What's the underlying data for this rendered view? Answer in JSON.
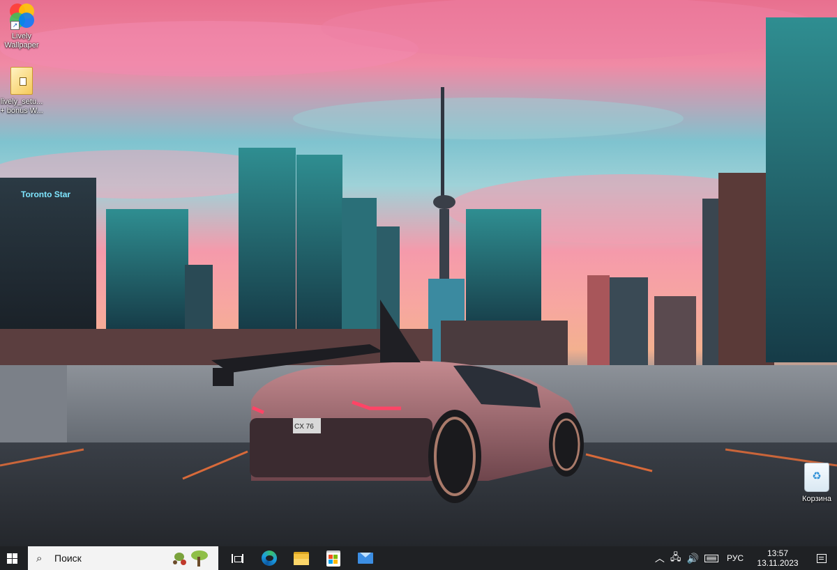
{
  "desktop": {
    "icons": [
      {
        "label": "Lively\nWallpaper",
        "icon": "lively-wallpaper-icon"
      },
      {
        "label": "lively_setu...\n+ bonus W...",
        "icon": "zip-archive-icon"
      },
      {
        "label": "Корзина",
        "icon": "recycle-bin-icon"
      }
    ],
    "wallpaper": {
      "signage": "Toronto Star",
      "plate": "CX 76"
    }
  },
  "taskbar": {
    "search": {
      "placeholder": "Поиск"
    },
    "pinned": [
      "task-view-icon",
      "edge-icon",
      "file-explorer-icon",
      "microsoft-store-icon",
      "mail-icon"
    ],
    "tray": {
      "language": "РУС",
      "time": "13:57",
      "date": "13.11.2023"
    }
  },
  "colors": {
    "taskbar_bg": "#1f2124",
    "search_bg": "#f3f3f3",
    "sky_pink": "#f08aa5",
    "sky_teal": "#7fc3cf"
  }
}
